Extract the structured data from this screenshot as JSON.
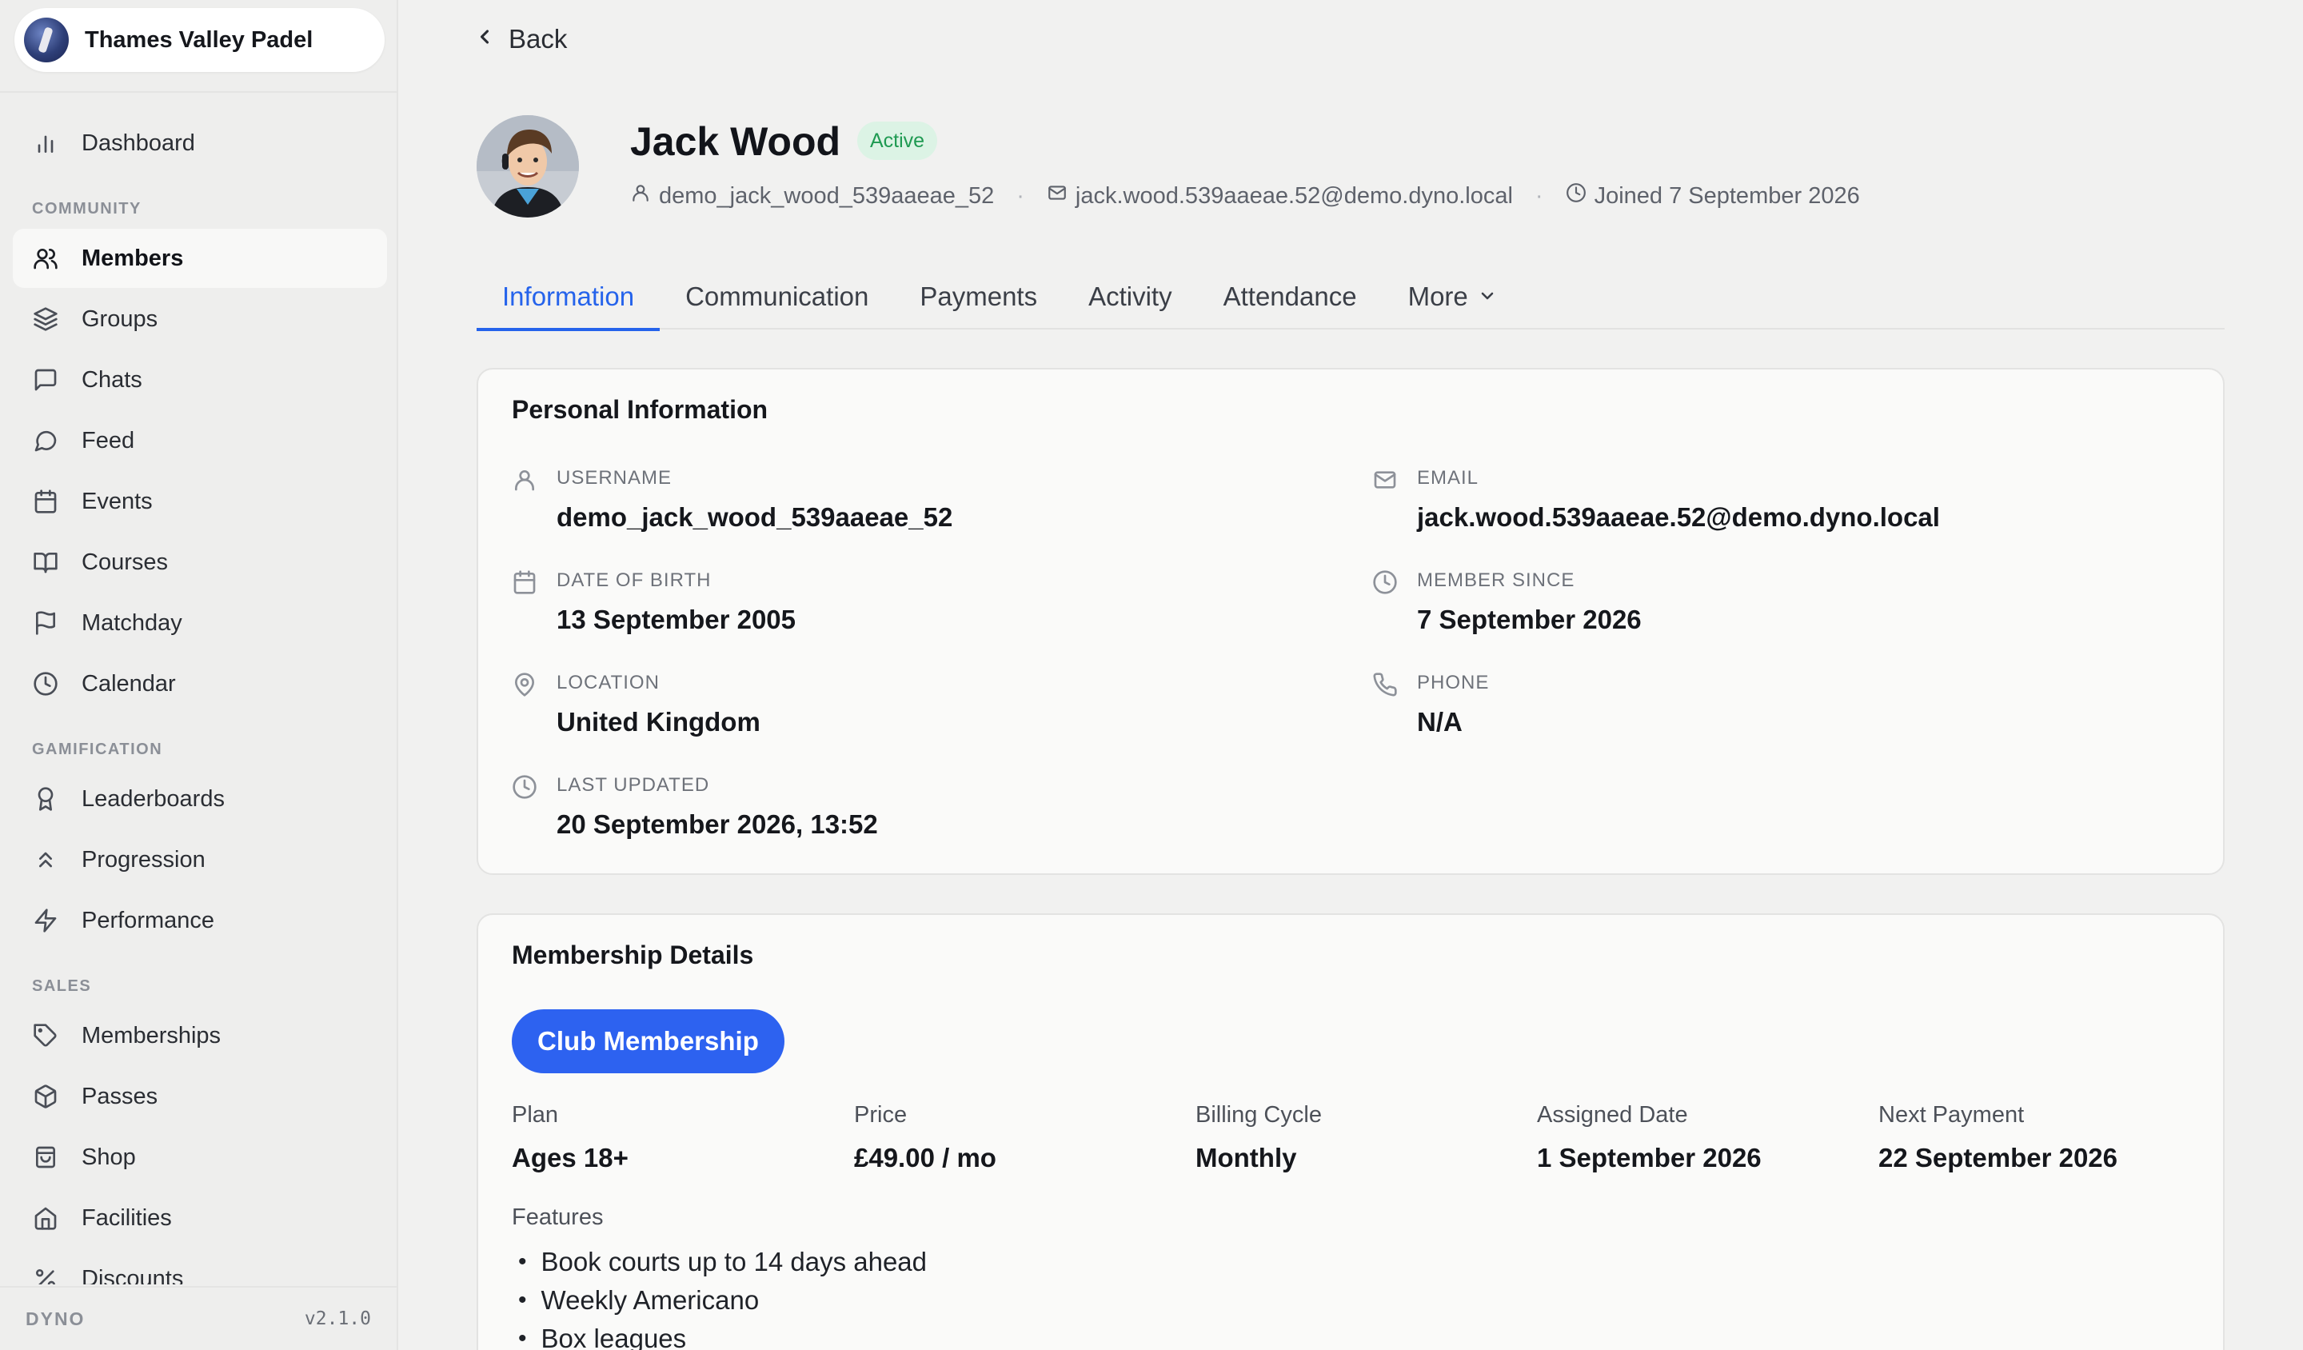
{
  "sidebar": {
    "club_name": "Thames Valley Padel",
    "items": [
      {
        "label": "Dashboard",
        "icon": "bar-chart-icon"
      },
      {
        "label": "Members",
        "icon": "users-icon"
      },
      {
        "label": "Groups",
        "icon": "layers-icon"
      },
      {
        "label": "Chats",
        "icon": "message-square-icon"
      },
      {
        "label": "Feed",
        "icon": "message-circle-icon"
      },
      {
        "label": "Events",
        "icon": "calendar-icon"
      },
      {
        "label": "Courses",
        "icon": "book-open-icon"
      },
      {
        "label": "Matchday",
        "icon": "flag-icon"
      },
      {
        "label": "Calendar",
        "icon": "clock-icon"
      },
      {
        "label": "Leaderboards",
        "icon": "award-icon"
      },
      {
        "label": "Progression",
        "icon": "chevrons-up-icon"
      },
      {
        "label": "Performance",
        "icon": "zap-icon"
      },
      {
        "label": "Memberships",
        "icon": "tag-icon"
      },
      {
        "label": "Passes",
        "icon": "package-icon"
      },
      {
        "label": "Shop",
        "icon": "shopping-bag-icon"
      },
      {
        "label": "Facilities",
        "icon": "home-icon"
      },
      {
        "label": "Discounts",
        "icon": "percent-icon"
      }
    ],
    "sections": [
      "COMMUNITY",
      "GAMIFICATION",
      "SALES"
    ],
    "footer_brand": "DYNO",
    "footer_version": "v2.1.0"
  },
  "header": {
    "back_label": "Back"
  },
  "profile": {
    "name": "Jack Wood",
    "status": "Active",
    "username": "demo_jack_wood_539aaeae_52",
    "email": "jack.wood.539aaeae.52@demo.dyno.local",
    "joined": "Joined 7 September 2026"
  },
  "tabs": [
    "Information",
    "Communication",
    "Payments",
    "Activity",
    "Attendance",
    "More"
  ],
  "personal": {
    "title": "Personal Information",
    "fields": [
      {
        "label": "USERNAME",
        "value": "demo_jack_wood_539aaeae_52"
      },
      {
        "label": "EMAIL",
        "value": "jack.wood.539aaeae.52@demo.dyno.local"
      },
      {
        "label": "DATE OF BIRTH",
        "value": "13 September 2005"
      },
      {
        "label": "MEMBER SINCE",
        "value": "7 September 2026"
      },
      {
        "label": "LOCATION",
        "value": "United Kingdom"
      },
      {
        "label": "PHONE",
        "value": "N/A"
      },
      {
        "label": "LAST UPDATED",
        "value": "20 September 2026, 13:52"
      }
    ]
  },
  "membership": {
    "title": "Membership Details",
    "plan_name": "Club Membership",
    "columns": [
      {
        "label": "Plan",
        "value": "Ages 18+"
      },
      {
        "label": "Price",
        "value": "£49.00 / mo"
      },
      {
        "label": "Billing Cycle",
        "value": "Monthly"
      },
      {
        "label": "Assigned Date",
        "value": "1 September 2026"
      },
      {
        "label": "Next Payment",
        "value": "22 September 2026"
      }
    ],
    "features_label": "Features",
    "features": [
      "Book courts up to 14 days ahead",
      "Weekly Americano",
      "Box leagues"
    ]
  },
  "colors": {
    "accent": "#2563eb",
    "status_bg": "#dcf3e5",
    "status_text": "#1f9a52"
  }
}
